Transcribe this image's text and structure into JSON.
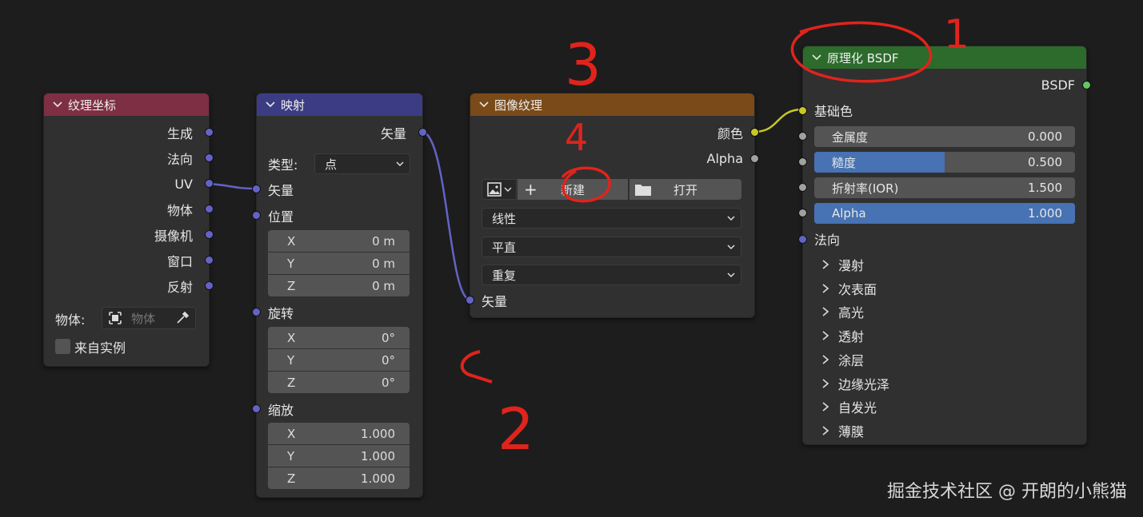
{
  "colors": {
    "texcoord_header": "#7e2f44",
    "mapping_header": "#3c3c84",
    "image_header": "#7a4a18",
    "bsdf_header": "#2c6b2c",
    "socket_vector": "#6363c7",
    "socket_color": "#c7c729",
    "socket_float": "#a1a1a1",
    "socket_shader": "#63c763",
    "slider_fill": "#4772b3",
    "annotation_red": "#e0241c"
  },
  "texcoord": {
    "title": "纹理坐标",
    "outputs": [
      "生成",
      "法向",
      "UV",
      "物体",
      "摄像机",
      "窗口",
      "反射"
    ],
    "object_label": "物体:",
    "object_placeholder": "物体",
    "from_instancer": "来自实例"
  },
  "mapping": {
    "title": "映射",
    "output_vector": "矢量",
    "type_label": "类型:",
    "type_value": "点",
    "input_vector": "矢量",
    "location_label": "位置",
    "location": [
      {
        "axis": "X",
        "value": "0 m"
      },
      {
        "axis": "Y",
        "value": "0 m"
      },
      {
        "axis": "Z",
        "value": "0 m"
      }
    ],
    "rotation_label": "旋转",
    "rotation": [
      {
        "axis": "X",
        "value": "0°"
      },
      {
        "axis": "Y",
        "value": "0°"
      },
      {
        "axis": "Z",
        "value": "0°"
      }
    ],
    "scale_label": "缩放",
    "scale": [
      {
        "axis": "X",
        "value": "1.000"
      },
      {
        "axis": "Y",
        "value": "1.000"
      },
      {
        "axis": "Z",
        "value": "1.000"
      }
    ]
  },
  "image": {
    "title": "图像纹理",
    "output_color": "颜色",
    "output_alpha": "Alpha",
    "new_label": "新建",
    "open_label": "打开",
    "plus": "+",
    "interpolation": "线性",
    "projection": "平直",
    "extension": "重复",
    "input_vector": "矢量"
  },
  "bsdf": {
    "title": "原理化 BSDF",
    "output": "BSDF",
    "base_color": "基础色",
    "metallic": {
      "label": "金属度",
      "value": "0.000",
      "fraction": 0.0
    },
    "roughness": {
      "label": "糙度",
      "value": "0.500",
      "fraction": 0.5
    },
    "ior": {
      "label": "折射率(IOR)",
      "value": "1.500",
      "fraction": 0.0
    },
    "alpha": {
      "label": "Alpha",
      "value": "1.000",
      "fraction": 1.0
    },
    "normal": "法向",
    "panels": [
      "漫射",
      "次表面",
      "高光",
      "透射",
      "涂层",
      "边缘光泽",
      "自发光",
      "薄膜"
    ]
  },
  "annotations": {
    "n1": "1",
    "n2": "2",
    "n3": "3",
    "n4": "4"
  },
  "watermark": "掘金技术社区 @ 开朗的小熊猫"
}
